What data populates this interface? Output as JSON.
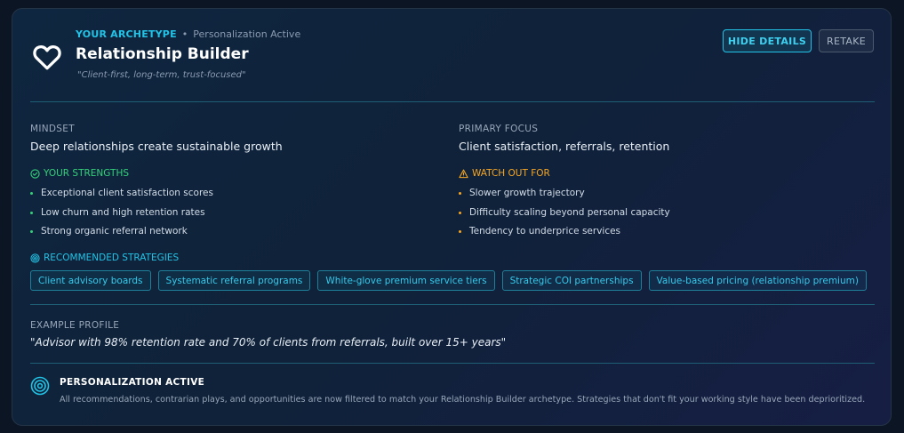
{
  "header": {
    "archetype_label": "YOUR ARCHETYPE",
    "separator": "•",
    "personalization_status": "Personalization Active",
    "title": "Relationship Builder",
    "tagline": "\"Client-first, long-term, trust-focused\"",
    "icon": "heart-icon"
  },
  "actions": {
    "hide_details": "HIDE DETAILS",
    "retake": "RETAKE"
  },
  "mindset": {
    "label": "MINDSET",
    "value": "Deep relationships create sustainable growth"
  },
  "primary_focus": {
    "label": "PRIMARY FOCUS",
    "value": "Client satisfaction, referrals, retention"
  },
  "strengths": {
    "label": "YOUR STRENGTHS",
    "icon": "check-circle-icon",
    "items": [
      "Exceptional client satisfaction scores",
      "Low churn and high retention rates",
      "Strong organic referral network"
    ]
  },
  "watch_out": {
    "label": "WATCH OUT FOR",
    "icon": "warning-icon",
    "items": [
      "Slower growth trajectory",
      "Difficulty scaling beyond personal capacity",
      "Tendency to underprice services"
    ]
  },
  "strategies": {
    "label": "RECOMMENDED STRATEGIES",
    "icon": "target-icon",
    "items": [
      "Client advisory boards",
      "Systematic referral programs",
      "White-glove premium service tiers",
      "Strategic COI partnerships",
      "Value-based pricing (relationship premium)"
    ]
  },
  "example": {
    "label": "EXAMPLE PROFILE",
    "quote": "\"Advisor with 98% retention rate and 70% of clients from referrals, built over 15+ years\""
  },
  "personalization": {
    "title": "PERSONALIZATION ACTIVE",
    "icon": "target-icon",
    "description": "All recommendations, contrarian plays, and opportunities are now filtered to match your Relationship Builder archetype. Strategies that don't fit your working style have been deprioritized."
  },
  "colors": {
    "accent": "#22c3e6",
    "success": "#34d17a",
    "warning": "#f5a623",
    "background": "#0f2239"
  }
}
